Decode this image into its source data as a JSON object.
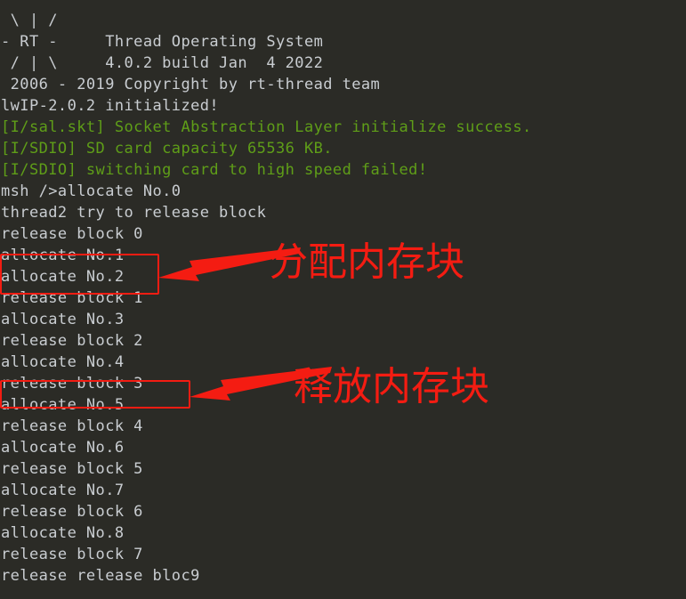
{
  "terminal": {
    "background_color": "#2b2b26",
    "text_color": "#c9cdd1",
    "log_color": "#5f9e18",
    "annotation_color": "#f41c12",
    "lines": [
      {
        "text": " \\ | /",
        "style": "banner"
      },
      {
        "text": "- RT -     Thread Operating System",
        "style": "banner"
      },
      {
        "text": " / | \\     4.0.2 build Jan  4 2022",
        "style": "banner"
      },
      {
        "text": " 2006 - 2019 Copyright by rt-thread team",
        "style": "banner"
      },
      {
        "text": "lwIP-2.0.2 initialized!",
        "style": "normal"
      },
      {
        "text": "[I/sal.skt] Socket Abstraction Layer initialize success.",
        "style": "green"
      },
      {
        "text": "[I/SDIO] SD card capacity 65536 KB.",
        "style": "green"
      },
      {
        "text": "[I/SDIO] switching card to high speed failed!",
        "style": "green"
      },
      {
        "text": "msh />allocate No.0",
        "style": "normal"
      },
      {
        "text": "thread2 try to release block",
        "style": "normal"
      },
      {
        "text": "release block 0",
        "style": "normal"
      },
      {
        "text": "allocate No.1",
        "style": "normal"
      },
      {
        "text": "allocate No.2",
        "style": "normal"
      },
      {
        "text": "release block 1",
        "style": "normal"
      },
      {
        "text": "allocate No.3",
        "style": "normal"
      },
      {
        "text": "release block 2",
        "style": "normal"
      },
      {
        "text": "allocate No.4",
        "style": "normal"
      },
      {
        "text": "release block 3",
        "style": "normal"
      },
      {
        "text": "allocate No.5",
        "style": "normal"
      },
      {
        "text": "release block 4",
        "style": "normal"
      },
      {
        "text": "allocate No.6",
        "style": "normal"
      },
      {
        "text": "release block 5",
        "style": "normal"
      },
      {
        "text": "allocate No.7",
        "style": "normal"
      },
      {
        "text": "release block 6",
        "style": "normal"
      },
      {
        "text": "allocate No.8",
        "style": "normal"
      },
      {
        "text": "release block 7",
        "style": "normal"
      },
      {
        "text": "release release bloc9",
        "style": "normal"
      }
    ]
  },
  "annotations": {
    "allocate": {
      "label": "分配内存块",
      "highlight_lines": [
        "allocate No.1",
        "allocate No.2"
      ]
    },
    "release": {
      "label": "释放内存块",
      "highlight_lines": [
        "release block 3"
      ]
    }
  }
}
